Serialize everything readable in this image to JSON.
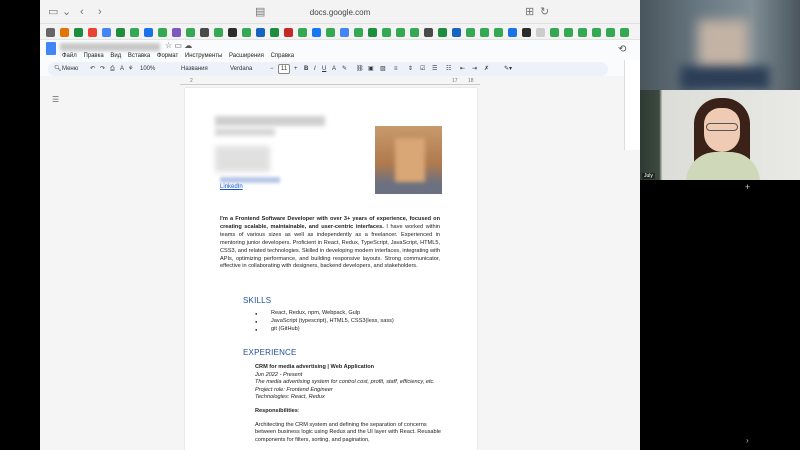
{
  "browser": {
    "address": "docs.google.com"
  },
  "docs": {
    "menu": [
      "Файл",
      "Правка",
      "Вид",
      "Вставка",
      "Формат",
      "Инструменты",
      "Расширения",
      "Справка"
    ],
    "toolbar": {
      "search": "Меню",
      "zoom": "100%",
      "style": "Названия",
      "font": "Verdana",
      "font_size": "11"
    },
    "ruler": {
      "left": "2",
      "right": "17",
      "right2": "18"
    }
  },
  "resume": {
    "linkedin": "LinkedIn",
    "summary_bold": "I'm a Frontend Software Developer with over 3+ years of experience, focused on creating scalable, maintainable, and user-centric interfaces.",
    "summary_rest": " I have worked within teams of various sizes as well as independently as a freelancer. Experienced in mentoring junior developers. Proficient in React, Redux, TypeScript, JavaScript, HTML5, CSS3, and related technologies. Skilled in developing modern interfaces, integrating with APIs, optimizing performance, and building responsive layouts. Strong communicator, effective in collaborating with designers, backend developers, and stakeholders.",
    "skills_heading": "SKILLS",
    "skills": [
      "React, Redux, npm, Webpack, Gulp",
      "JavaScript (typescript), HTML5, CSS3(less, sass)",
      "git (GitHub)"
    ],
    "experience_heading": "EXPERIENCE",
    "job": {
      "title": "CRM for media advertising | Web Application",
      "dates": "Jun 2022 - Present",
      "description": "The media advertising system for control cost, profit, staff, efficiency, etc.",
      "role": "Project role: Frontend Engineer",
      "tech": "Technologies: React, Redux",
      "resp_heading": "Responsibilities",
      "resp_colon": ":",
      "resp_text": "Architecting the CRM system and defining the separation of concerns between business logic using Redux and the UI layer with React. Reusable components for filters, sorting, and pagination,"
    }
  },
  "video": {
    "tile_label": "July"
  }
}
